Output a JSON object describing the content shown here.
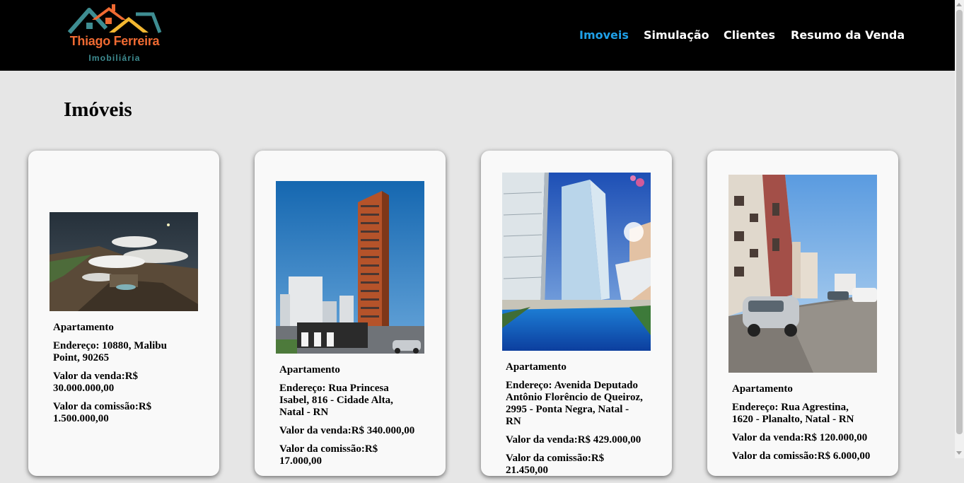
{
  "header": {
    "logo_name": "Thiago Ferreira",
    "logo_subtitle": "Imobiliária",
    "nav": [
      {
        "label": "Imoveis",
        "active": true
      },
      {
        "label": "Simulação",
        "active": false
      },
      {
        "label": "Clientes",
        "active": false
      },
      {
        "label": "Resumo da Venda",
        "active": false
      }
    ]
  },
  "main": {
    "title": "Imóveis",
    "properties": [
      {
        "type": "Apartamento",
        "address": "Endereço: 10880, Malibu Point, 90265",
        "sale_value": "Valor da venda:R$ 30.000.000,00",
        "commission": "Valor da comissão:R$ 1.500.000,00"
      },
      {
        "type": "Apartamento",
        "address": "Endereço: Rua Princesa Isabel, 816 - Cidade Alta, Natal - RN",
        "sale_value": "Valor da venda:R$ 340.000,00",
        "commission": "Valor da comissão:R$ 17.000,00"
      },
      {
        "type": "Apartamento",
        "address": "Endereço: Avenida Deputado Antônio Florêncio de Queiroz, 2995 - Ponta Negra, Natal - RN",
        "sale_value": "Valor da venda:R$ 429.000,00",
        "commission": "Valor da comissão:R$ 21.450,00"
      },
      {
        "type": "Apartamento",
        "address": "Endereço: Rua Agrestina, 1620 - Planalto, Natal - RN",
        "sale_value": "Valor da venda:R$ 120.000,00",
        "commission": "Valor da comissão:R$ 6.000,00"
      }
    ]
  },
  "colors": {
    "header_bg": "#000000",
    "nav_active": "#1fa0e8",
    "logo_orange": "#ef6a32",
    "logo_teal": "#3e8d92",
    "page_bg": "#e6e6e6"
  }
}
